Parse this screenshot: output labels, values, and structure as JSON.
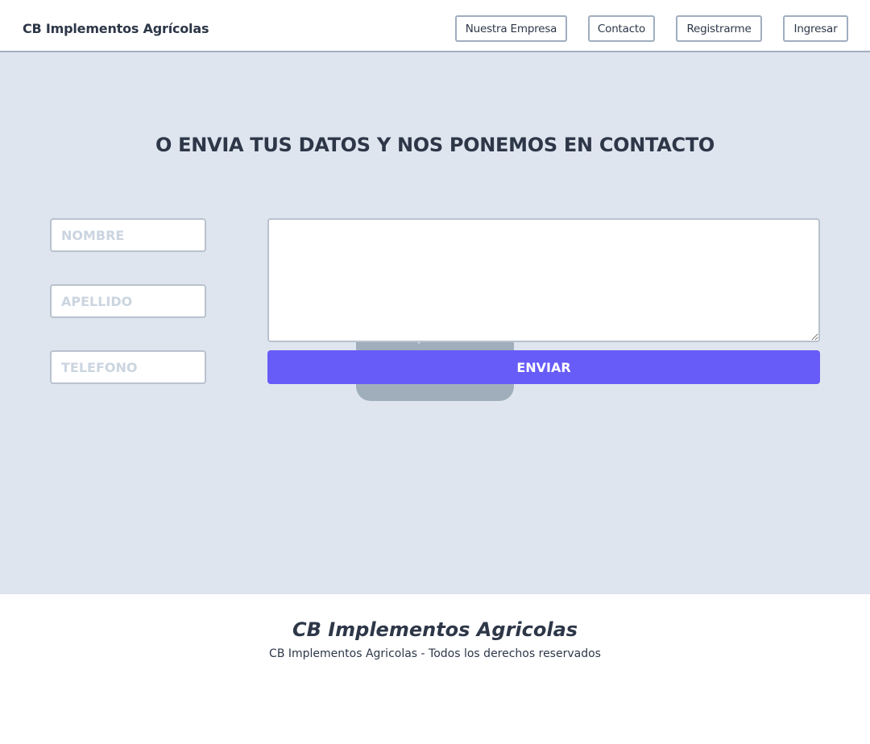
{
  "header": {
    "brand": "CB Implementos Agrícolas",
    "nav": [
      {
        "label": "Nuestra Empresa"
      },
      {
        "label": "Contacto"
      },
      {
        "label": "Registrarme"
      },
      {
        "label": "Ingresar"
      }
    ]
  },
  "contact": {
    "title": "O ENVIA TUS DATOS Y NOS PONEMOS EN CONTACTO",
    "nombre_placeholder": "NOMBRE",
    "apellido_placeholder": "APELLIDO",
    "telefono_placeholder": "TELEFONO",
    "message_value": "",
    "send_label": "ENVIAR"
  },
  "footer": {
    "title": "CB Implementos Agricolas",
    "copyright": "CB Implementos Agricolas - Todos los derechos reservados"
  },
  "colors": {
    "page_bg": "#dfe5ee",
    "accent": "#675cf8",
    "text": "#2d3748",
    "border": "#a0aec0"
  }
}
